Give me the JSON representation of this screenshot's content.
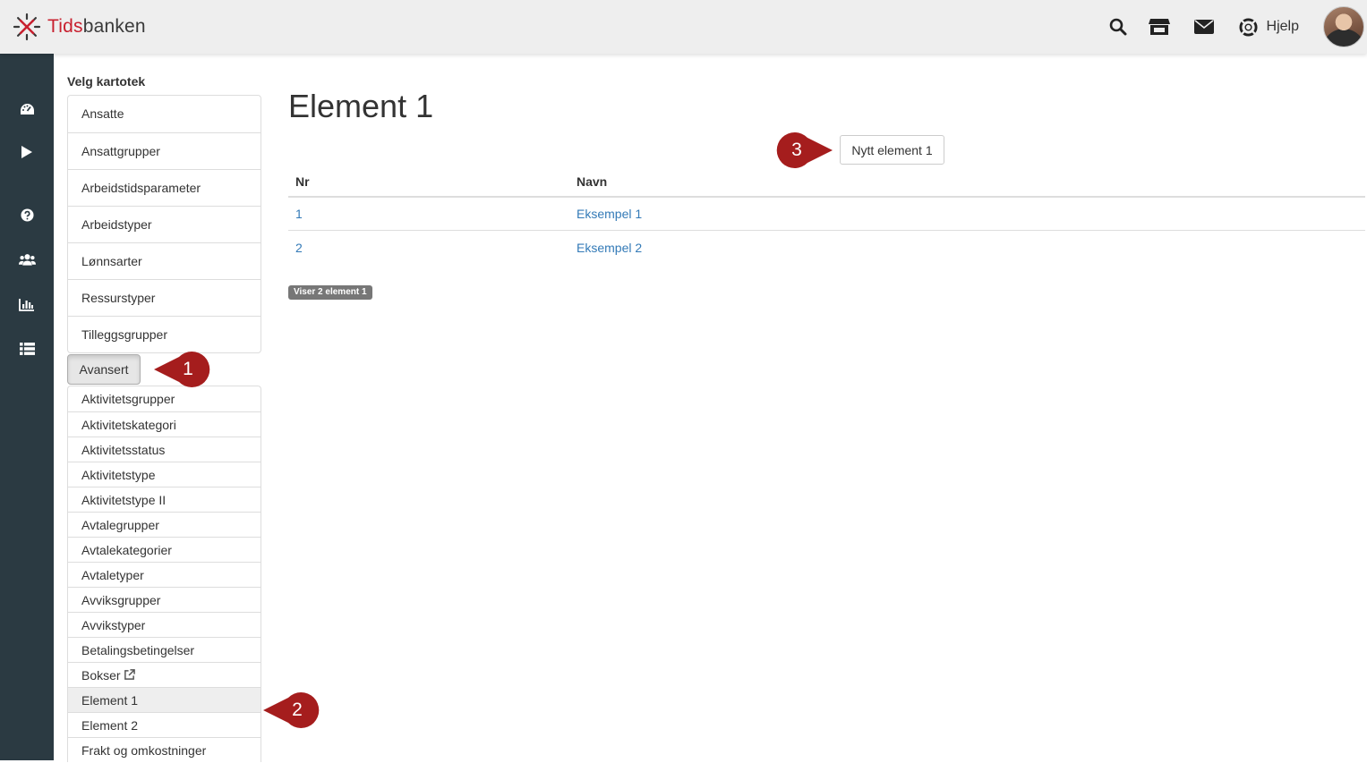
{
  "brand": {
    "name_part1": "Tids",
    "name_part2": "banken",
    "accent": "#c8202f"
  },
  "header": {
    "icons": [
      "search-icon",
      "store-icon",
      "envelope-icon",
      "lifebuoy-icon"
    ],
    "help_label": "Hjelp"
  },
  "rail": {
    "icons": [
      "dashboard-icon",
      "play-icon",
      "question-icon",
      "users-icon",
      "bar-chart-icon",
      "list-icon"
    ]
  },
  "cabinet": {
    "title": "Velg kartotek",
    "items": [
      {
        "label": "Ansatte"
      },
      {
        "label": "Ansattgrupper"
      },
      {
        "label": "Arbeidstidsparameter"
      },
      {
        "label": "Arbeidstyper"
      },
      {
        "label": "Lønnsarter"
      },
      {
        "label": "Ressurstyper"
      },
      {
        "label": "Tilleggsgrupper"
      }
    ],
    "advanced_label": "Avansert",
    "advanced_items": [
      {
        "label": "Aktivitetsgrupper"
      },
      {
        "label": "Aktivitetskategori"
      },
      {
        "label": "Aktivitetsstatus"
      },
      {
        "label": "Aktivitetstype"
      },
      {
        "label": "Aktivitetstype II"
      },
      {
        "label": "Avtalegrupper"
      },
      {
        "label": "Avtalekategorier"
      },
      {
        "label": "Avtaletyper"
      },
      {
        "label": "Avviksgrupper"
      },
      {
        "label": "Avvikstyper"
      },
      {
        "label": "Betalingsbetingelser"
      },
      {
        "label": "Bokser"
      },
      {
        "label": "Element 1"
      },
      {
        "label": "Element 2"
      },
      {
        "label": "Frakt og omkostninger"
      }
    ]
  },
  "main": {
    "title": "Element 1",
    "new_button": "Nytt element 1",
    "columns": [
      "Nr",
      "Navn"
    ],
    "rows": [
      {
        "nr": "1",
        "navn": "Eksempel 1"
      },
      {
        "nr": "2",
        "navn": "Eksempel 2"
      }
    ],
    "count_label": "Viser 2 element 1"
  },
  "callouts": [
    "1",
    "2",
    "3"
  ],
  "colors": {
    "rail": "#2b3a42",
    "link": "#337ab7",
    "callout": "#a51d1d"
  }
}
